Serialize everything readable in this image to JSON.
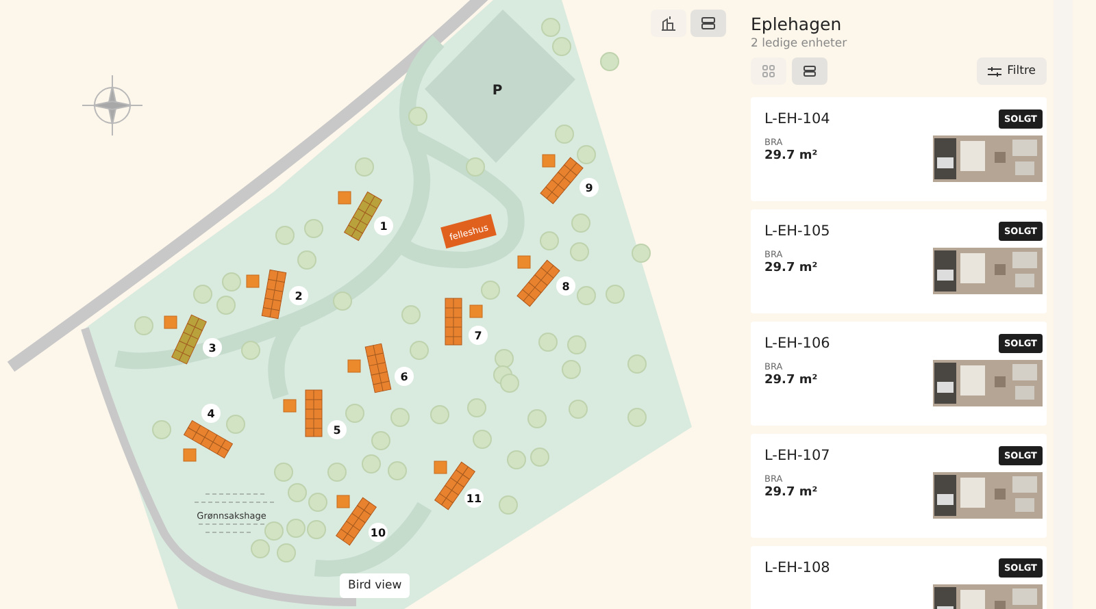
{
  "map": {
    "view_buttons": [
      {
        "kind": "buildings",
        "selected": false
      },
      {
        "kind": "list",
        "selected": true
      }
    ],
    "parking_label": "P",
    "common_house_label": "felleshus",
    "garden_label": "Grønnsakshage",
    "plots": [
      {
        "number": "1",
        "color": "#b9a13c"
      },
      {
        "number": "2",
        "color": "#e8822e"
      },
      {
        "number": "3",
        "color": "#b9a13c"
      },
      {
        "number": "4",
        "color": "#e8822e"
      },
      {
        "number": "5",
        "color": "#e8822e"
      },
      {
        "number": "6",
        "color": "#e8822e"
      },
      {
        "number": "7",
        "color": "#e8822e"
      },
      {
        "number": "8",
        "color": "#e8822e"
      },
      {
        "number": "9",
        "color": "#e8822e"
      },
      {
        "number": "10",
        "color": "#e8822e"
      },
      {
        "number": "11",
        "color": "#e8822e"
      }
    ],
    "bird_view_button": "Bird view"
  },
  "panel": {
    "title": "Eplehagen",
    "subtitle": "2 ledige enheter",
    "layout_buttons": [
      {
        "kind": "grid",
        "selected": false
      },
      {
        "kind": "list",
        "selected": true
      }
    ],
    "filter_button": "Filtre",
    "units": [
      {
        "name": "L-EH-104",
        "badge": "SOLGT",
        "area_label": "BRA",
        "area": "29.7 m²"
      },
      {
        "name": "L-EH-105",
        "badge": "SOLGT",
        "area_label": "BRA",
        "area": "29.7 m²"
      },
      {
        "name": "L-EH-106",
        "badge": "SOLGT",
        "area_label": "BRA",
        "area": "29.7 m²"
      },
      {
        "name": "L-EH-107",
        "badge": "SOLGT",
        "area_label": "BRA",
        "area": "29.7 m²"
      },
      {
        "name": "L-EH-108",
        "badge": "SOLGT"
      }
    ]
  }
}
